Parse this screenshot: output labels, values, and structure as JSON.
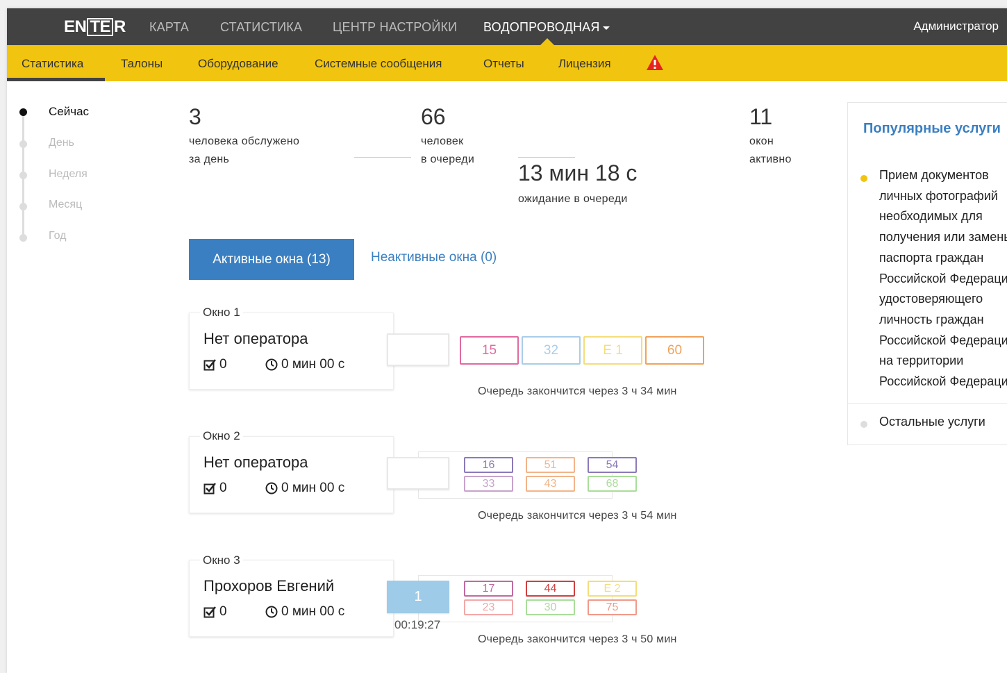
{
  "header": {
    "logo": {
      "pre": "EN",
      "box": "TE",
      "post": "R"
    },
    "nav": [
      "КАРТА",
      "СТАТИСТИКА",
      "ЦЕНТР НАСТРОЙКИ",
      "ВОДОПРОВОДНАЯ"
    ],
    "user": "Администратор"
  },
  "subnav": {
    "tabs": [
      "Статистика",
      "Талоны",
      "Оборудование",
      "Системные сообщения",
      "Отчеты",
      "Лицензия"
    ]
  },
  "periods": [
    "Сейчас",
    "День",
    "Неделя",
    "Месяц",
    "Год"
  ],
  "stats": {
    "served": {
      "value": "3",
      "line1": "человека обслужено",
      "line2": "за день"
    },
    "queue": {
      "value": "66",
      "line1": "человек",
      "line2": "в очереди"
    },
    "wait": {
      "value": "13 мин 18 с",
      "line1": "ожидание в очереди"
    },
    "windows": {
      "value": "11",
      "line1": "окон",
      "line2": "активно"
    }
  },
  "tabs": {
    "active": "Активные окна (13)",
    "inactive": "Неактивные окна (0)"
  },
  "windows": [
    {
      "label": "Окно 1",
      "operator": "Нет оператора",
      "served": "0",
      "time": "0 мин 00 с",
      "queue_end": "Очередь закончится через 3 ч 34 мин",
      "tickets": [
        "15",
        "32",
        "Е 1",
        "60"
      ],
      "ticket_colors": [
        "#e06aa0",
        "#a9cde8",
        "#f5dd7a",
        "#f0a25a"
      ]
    },
    {
      "label": "Окно 2",
      "operator": "Нет оператора",
      "served": "0",
      "time": "0 мин 00 с",
      "queue_end": "Очередь закончится через 3 ч 54 мин",
      "tickets": [
        "16",
        "51",
        "54",
        "33",
        "43",
        "68"
      ],
      "ticket_colors": [
        "#8a7ab8",
        "#f2b48a",
        "#8a7ab8",
        "#c8a2cc",
        "#f2b48a",
        "#a9dd9a"
      ]
    },
    {
      "label": "Окно 3",
      "operator": "Прохоров Евгений",
      "served": "0",
      "time": "0 мин 00 с",
      "current_ticket": "1",
      "current_time": "00:19:27",
      "queue_end": "Очередь закончится через 3 ч 50 мин",
      "tickets": [
        "17",
        "44",
        "Е 2",
        "23",
        "30",
        "75"
      ],
      "ticket_colors": [
        "#c06aa0",
        "#d04040",
        "#f5dd7a",
        "#f2a8a8",
        "#a9dd9a",
        "#f09a8a"
      ]
    }
  ],
  "popular": {
    "title": "Популярные услуги",
    "item_lines": [
      "Прием документов",
      "личных фотографий",
      "необходимых для",
      "получения или замены",
      "паспорта граждан",
      "Российской Федерации",
      "удостоверяющего",
      "личность граждан",
      "Российской Федерации",
      "на территории",
      "Российской Федерации"
    ],
    "rest": "Остальные услуги",
    "colors": {
      "main": "#f1c40f",
      "rest": "#ddd"
    }
  },
  "icons": {
    "warning": "warning-triangle-icon",
    "served": "checkbox-icon",
    "time": "clock-icon"
  },
  "colors": {
    "topbar": "#424242",
    "accent_bar": "#f1c40f",
    "primary": "#3a7fc1",
    "warning": "#e52320"
  }
}
